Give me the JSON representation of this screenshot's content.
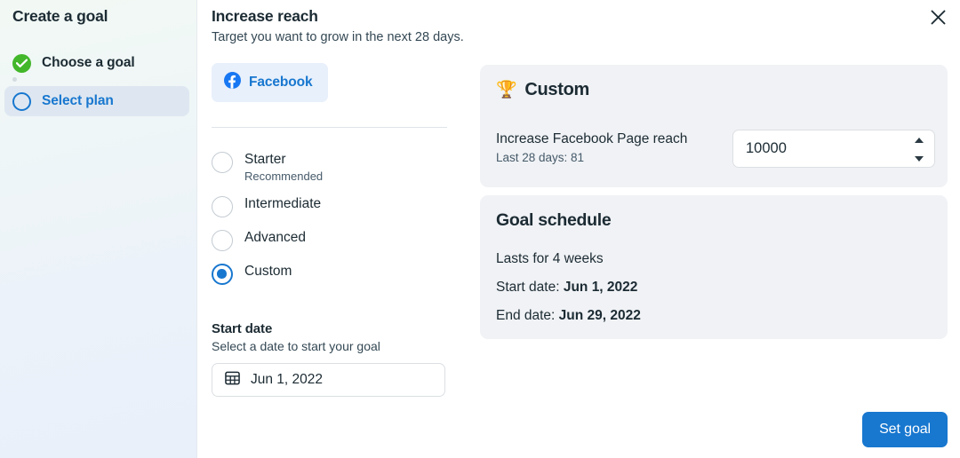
{
  "sidebar": {
    "title": "Create a goal",
    "steps": [
      {
        "label": "Choose a goal",
        "state": "completed",
        "icon": "check-circle-icon"
      },
      {
        "label": "Select plan",
        "state": "active",
        "icon": "circle-outline-icon"
      }
    ]
  },
  "header": {
    "title": "Increase reach",
    "subtitle": "Target you want to grow in the next 28 days.",
    "close_icon": "close-icon"
  },
  "platform_tabs": [
    {
      "label": "Facebook",
      "icon": "facebook-icon",
      "selected": true
    }
  ],
  "plans": [
    {
      "label": "Starter",
      "sub": "Recommended",
      "selected": false
    },
    {
      "label": "Intermediate",
      "sub": "",
      "selected": false
    },
    {
      "label": "Advanced",
      "sub": "",
      "selected": false
    },
    {
      "label": "Custom",
      "sub": "",
      "selected": true
    }
  ],
  "start_date": {
    "title": "Start date",
    "subtitle": "Select a date to start your goal",
    "value": "Jun 1, 2022",
    "icon": "calendar-icon"
  },
  "custom_card": {
    "title": "Custom",
    "icon": "trophy-icon",
    "metric_label": "Increase Facebook Page reach",
    "metric_sub": "Last 28 days: 81",
    "target_value": "10000"
  },
  "schedule_card": {
    "title": "Goal schedule",
    "duration": "Lasts for 4 weeks",
    "start_prefix": "Start date: ",
    "start_value": "Jun 1, 2022",
    "end_prefix": "End date: ",
    "end_value": "Jun 29, 2022"
  },
  "footer": {
    "submit_label": "Set goal"
  },
  "colors": {
    "accent_blue": "#1877cf",
    "success_green": "#42b72a",
    "card_bg": "#f0f2f5",
    "trophy_gold": "#f7b928"
  }
}
